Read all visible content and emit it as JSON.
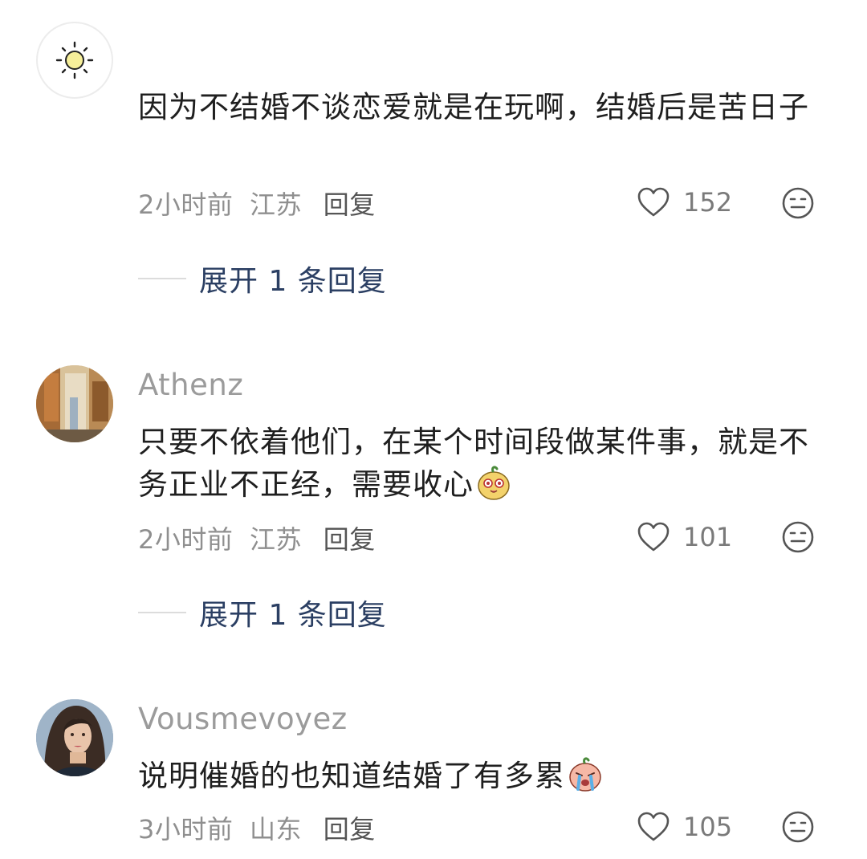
{
  "comments": [
    {
      "username": "",
      "text": "因为不结婚不谈恋爱就是在玩啊，结婚后是苦日子",
      "time": "2小时前",
      "location": "江苏",
      "reply_label": "回复",
      "likes": "152",
      "expand_label": "展开 1 条回复",
      "avatar_icon": "sun-icon"
    },
    {
      "username": "Athenz",
      "text": "只要不依着他们，在某个时间段做某件事，就是不务正业不正经，需要收心",
      "time": "2小时前",
      "location": "江苏",
      "reply_label": "回复",
      "likes": "101",
      "expand_label": "展开 1 条回复",
      "emoji_icon": "cute-emoji-icon"
    },
    {
      "username": "Vousmevoyez",
      "text": "说明催婚的也知道结婚了有多累",
      "time": "3小时前",
      "location": "山东",
      "reply_label": "回复",
      "likes": "105",
      "emoji_icon": "crying-emoji-icon"
    }
  ],
  "colors": {
    "username": "#9b9b9b",
    "text": "#1f1f1f",
    "meta": "#8f8f8f",
    "expand": "#2b3f63"
  }
}
